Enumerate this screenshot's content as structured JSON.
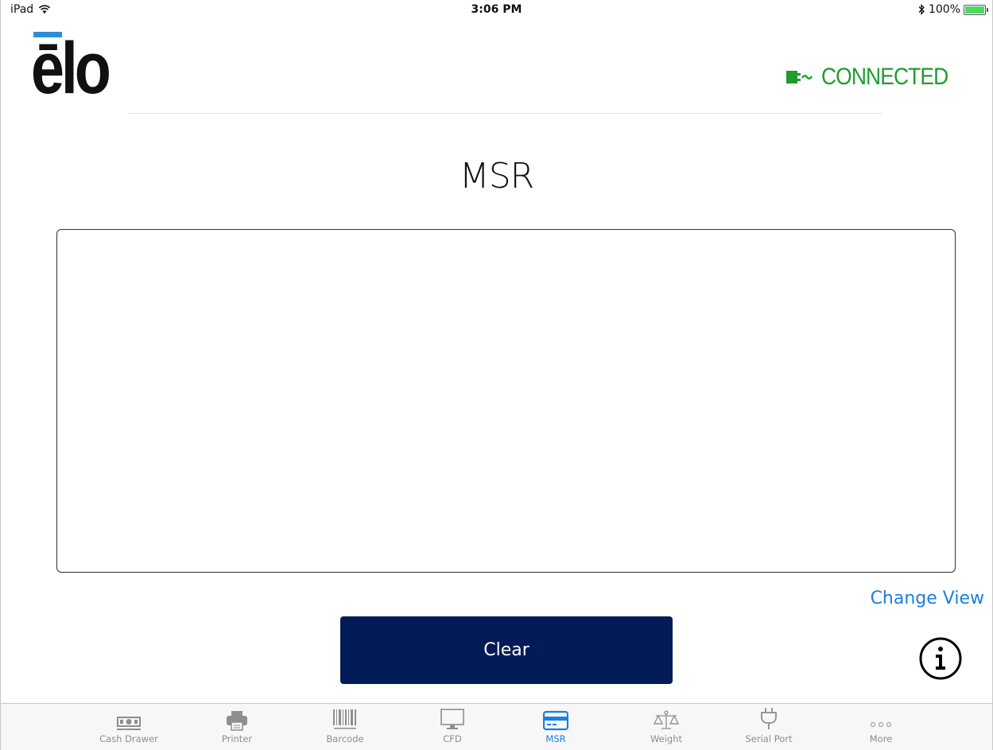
{
  "status_bar": {
    "device": "iPad",
    "time": "3:06 PM",
    "battery": "100%"
  },
  "header": {
    "logo_text": "ēlo",
    "connection_status": "CONNECTED"
  },
  "main": {
    "title": "MSR",
    "textview_content": "",
    "change_view_label": "Change View",
    "clear_label": "Clear"
  },
  "tabs": [
    {
      "label": "Cash Drawer",
      "icon": "cash-drawer-icon"
    },
    {
      "label": "Printer",
      "icon": "printer-icon"
    },
    {
      "label": "Barcode",
      "icon": "barcode-icon"
    },
    {
      "label": "CFD",
      "icon": "monitor-icon"
    },
    {
      "label": "MSR",
      "icon": "credit-card-icon",
      "active": true
    },
    {
      "label": "Weight",
      "icon": "scale-icon"
    },
    {
      "label": "Serial Port",
      "icon": "plug-icon"
    },
    {
      "label": "More",
      "icon": "more-dots-icon"
    }
  ],
  "colors": {
    "accent": "#1a7fe0",
    "button_bg": "#031b57",
    "connected": "#1e9c2f",
    "logo_bar": "#2c8fd4"
  }
}
